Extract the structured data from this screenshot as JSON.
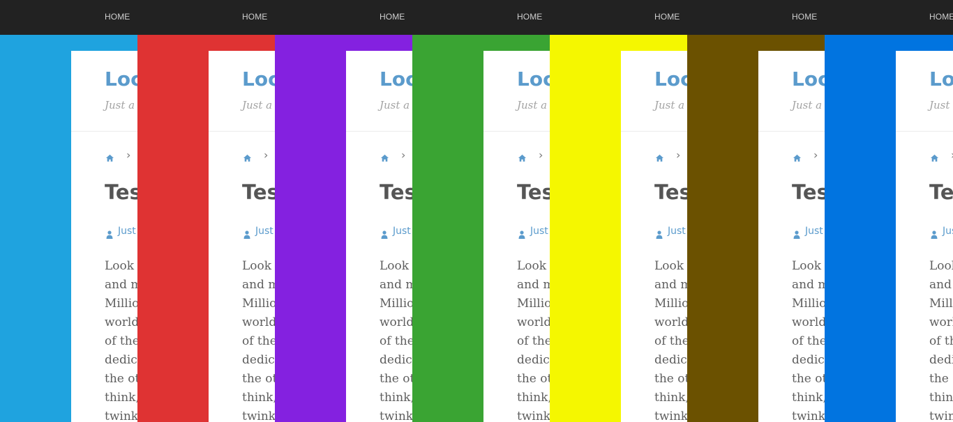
{
  "nav": {
    "home_label": "HOME"
  },
  "header": {
    "site_title": "Loc",
    "tagline": "Just a"
  },
  "post": {
    "title": "Tes",
    "author": "Just",
    "body_lines": [
      "Look",
      "and m",
      "Millio",
      "world",
      "of the",
      "dedic",
      "the ot",
      "think,",
      "twink"
    ]
  },
  "strips": [
    {
      "color": "#1fa3df"
    },
    {
      "color": "#df3333"
    },
    {
      "color": "#8421e0"
    },
    {
      "color": "#3aa433"
    },
    {
      "color": "#f5f700"
    },
    {
      "color": "#6b5100"
    },
    {
      "color": "#0174e0"
    }
  ],
  "colors": {
    "navbar": "#222222",
    "link": "#5b9bcc",
    "panel": "#ffffff"
  }
}
